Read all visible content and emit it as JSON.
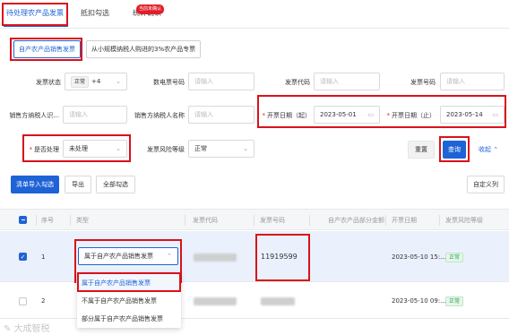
{
  "tabs": [
    {
      "label": "待处理农产品发票"
    },
    {
      "label": "抵扣勾选"
    },
    {
      "label": "统计确认"
    }
  ],
  "tab_badge": "当前未确认",
  "sub_tabs": [
    {
      "label": "自产农产品销售发票"
    },
    {
      "label": "从小规模纳税人购进的3%农产品专票"
    }
  ],
  "filters": {
    "invoice_status": {
      "label": "发票状态",
      "tag": "正常",
      "more": "+4"
    },
    "digital_invoice_no": {
      "label": "数电票号码",
      "placeholder": "请输入"
    },
    "invoice_code": {
      "label": "发票代码",
      "placeholder": "请输入"
    },
    "invoice_no": {
      "label": "发票号码",
      "placeholder": "请输入"
    },
    "seller_tax_id": {
      "label": "销售方纳税人识...",
      "placeholder": "请输入"
    },
    "seller_name": {
      "label": "销售方纳税人名称",
      "placeholder": "请输入"
    },
    "date_start": {
      "label": "开票日期（起）",
      "value": "2023-05-01"
    },
    "date_end": {
      "label": "开票日期（止）",
      "value": "2023-05-14"
    },
    "processed": {
      "label": "是否处理",
      "value": "未处理"
    },
    "risk_level": {
      "label": "发票风险等级",
      "value": "正常"
    }
  },
  "buttons": {
    "reset": "重置",
    "query": "查询",
    "collapse": "收起",
    "import_check": "清单导入勾选",
    "export": "导出",
    "check_all": "全部勾选",
    "custom_columns": "自定义列"
  },
  "table": {
    "headers": [
      "序号",
      "类型",
      "发票代码",
      "发票号码",
      "自产农产品部分金额",
      "开票日期",
      "发票风险等级"
    ],
    "rows": [
      {
        "index": "1",
        "type": "属于自产农产品销售发票",
        "invoice_no": "11919599",
        "date": "2023-05-10 15:...",
        "risk": "正常",
        "checked": true
      },
      {
        "index": "2",
        "type": "",
        "invoice_no": "",
        "date": "2023-05-10 09:...",
        "risk": "正常",
        "checked": false
      }
    ]
  },
  "type_options": [
    "属于自产农产品销售发票",
    "不属于自产农产品销售发票",
    "部分属于自产农产品销售发票"
  ],
  "watermark": "大成智税",
  "colors": {
    "accent": "#1e63d6",
    "highlight": "#d9121b",
    "status_ok": "#2ea44f"
  }
}
